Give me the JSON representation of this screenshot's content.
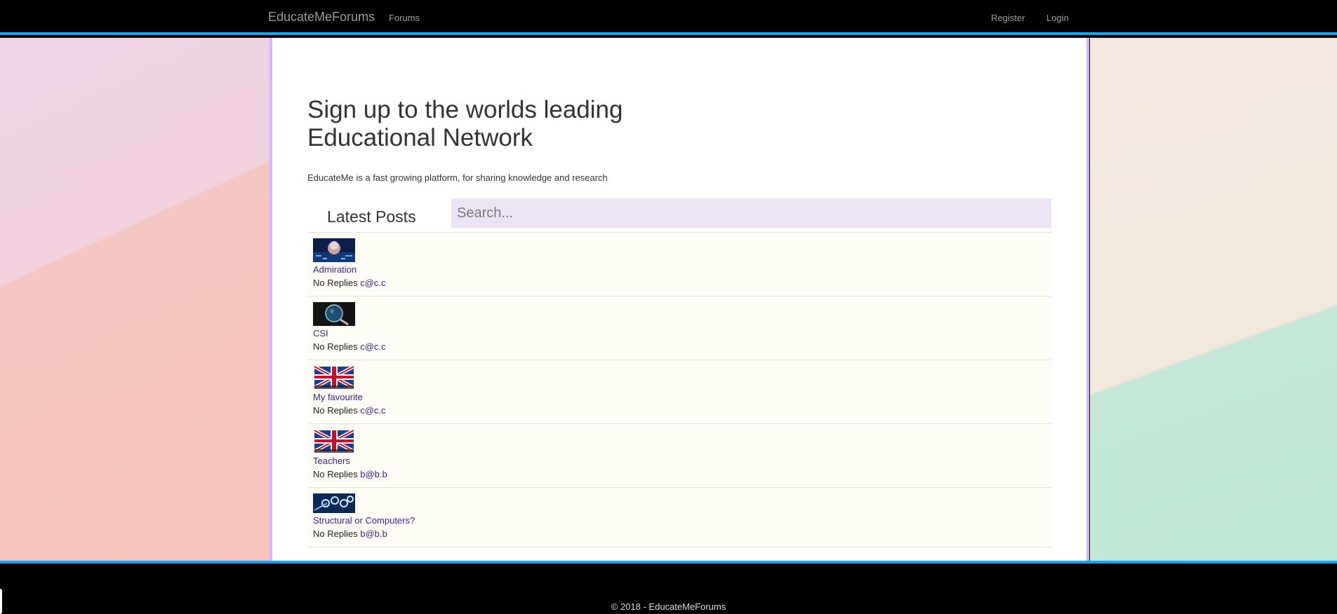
{
  "navbar": {
    "brand": "EducateMeForums",
    "links": {
      "forums": "Forums",
      "register": "Register",
      "login": "Login"
    }
  },
  "hero": {
    "title": "Sign up to the worlds leading Educational Network",
    "lead": "EducateMe is a fast growing platform, for sharing knowledge and research"
  },
  "latest": {
    "heading": "Latest Posts",
    "search_placeholder": "Search..."
  },
  "posts": [
    {
      "title": "Admiration",
      "replies": "No Replies",
      "author": "c@c.c",
      "thumb": "robot-face-image"
    },
    {
      "title": "CSI",
      "replies": "No Replies",
      "author": "c@c.c",
      "thumb": "magnifying-glass-image"
    },
    {
      "title": "My favourite",
      "replies": "No Replies",
      "author": "c@c.c",
      "thumb": "uk-flag-image"
    },
    {
      "title": "Teachers",
      "replies": "No Replies",
      "author": "b@b.b",
      "thumb": "uk-flag-image"
    },
    {
      "title": "Structural or Computers?",
      "replies": "No Replies",
      "author": "b@b.b",
      "thumb": "gears-image"
    }
  ],
  "footer": {
    "copyright": "© 2018 - EducateMeForums"
  },
  "colors": {
    "accent_blue": "#1aa3e8",
    "container_border": "#d8b4fe",
    "link_purple": "#3b1f8a",
    "search_bg": "#ece4f4"
  }
}
